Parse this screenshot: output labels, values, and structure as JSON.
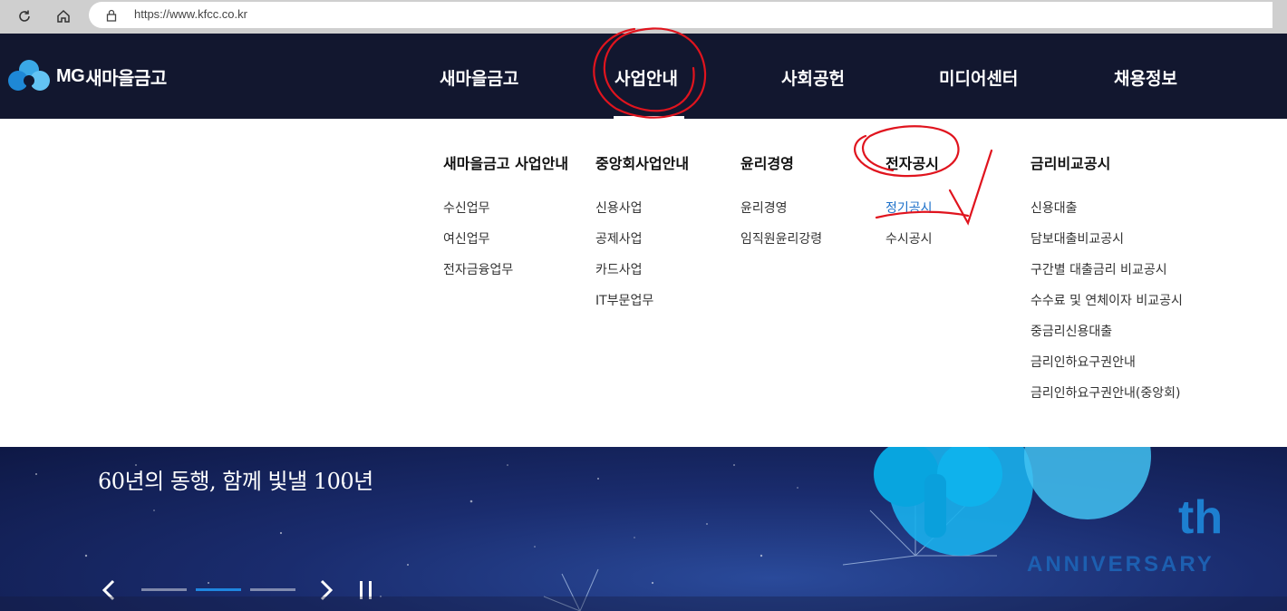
{
  "browser": {
    "url": "https://www.kfcc.co.kr"
  },
  "header": {
    "logo_mark": "MG",
    "logo_name": "새마을금고",
    "nav": [
      {
        "label": "새마을금고"
      },
      {
        "label": "사업안내"
      },
      {
        "label": "사회공헌"
      },
      {
        "label": "미디어센터"
      },
      {
        "label": "채용정보"
      }
    ]
  },
  "mega_menu": {
    "columns": [
      {
        "title": "새마을금고 사업안내",
        "links": [
          "수신업무",
          "여신업무",
          "전자금융업무"
        ]
      },
      {
        "title": "중앙회사업안내",
        "links": [
          "신용사업",
          "공제사업",
          "카드사업",
          "IT부문업무"
        ]
      },
      {
        "title": "윤리경영",
        "links": [
          "윤리경영",
          "임직원윤리강령"
        ]
      },
      {
        "title": "전자공시",
        "links": [
          "정기공시",
          "수시공시"
        ]
      },
      {
        "title": "금리비교공시",
        "links": [
          "신용대출",
          "담보대출비교공시",
          "구간별 대출금리 비교공시",
          "수수료 및 연체이자 비교공시",
          "중금리신용대출",
          "금리인하요구권안내",
          "금리인하요구권안내(중앙회)"
        ]
      }
    ],
    "active_link": "정기공시"
  },
  "hero": {
    "headline": "60년의 동행, 함께 빛낼 100년",
    "th_text": "th",
    "anniversary_text": "ANNIVERSARY",
    "slider": {
      "total": 3,
      "active_index": 1
    }
  },
  "colors": {
    "header_bg": "#12172f",
    "accent": "#1f86e0",
    "active_link": "#1b6fc9",
    "annotation": "#e0141e"
  }
}
